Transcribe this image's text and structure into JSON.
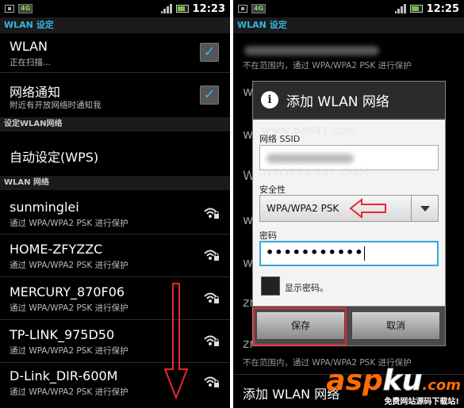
{
  "statusbar": {
    "time": "12:23",
    "time_right": "12:25",
    "network": "4G"
  },
  "left": {
    "header": "WLAN 设定",
    "wlan": {
      "title": "WLAN",
      "sub": "正在扫描..."
    },
    "notify": {
      "title": "网络通知",
      "sub": "附近有开放网络时通知我"
    },
    "section_setup": "设定WLAN网络",
    "wps": "自动设定(WPS)",
    "section_networks": "WLAN 网络",
    "networks": [
      {
        "ssid": "sunminglei",
        "sub": "通过 WPA/WPA2 PSK 进行保护"
      },
      {
        "ssid": "HOME-ZFYZZC",
        "sub": "通过 WPA/WPA2 PSK 进行保护"
      },
      {
        "ssid": "MERCURY_870F06",
        "sub": "通过 WPA/WPA2 PSK 进行保护"
      },
      {
        "ssid": "TP-LINK_975D50",
        "sub": "通过 WPA/WPA2 PSK 进行保护"
      },
      {
        "ssid": "D-Link_DIR-600M",
        "sub": "通过 WPA/WPA2 PSK 进行保护"
      }
    ],
    "check_glyph": "✓"
  },
  "right": {
    "header": "WLAN 设定",
    "out_of_range": "不在范围内，通过 WPA/WPA2 PSK 进行保护",
    "add_network": "添加 WLAN 网络",
    "zr": "zr"
  },
  "dialog": {
    "title": "添加 WLAN 网络",
    "info_glyph": "i",
    "ssid_label": "网络 SSID",
    "security_label": "安全性",
    "security_value": "WPA/WPA2 PSK",
    "password_label": "密码",
    "password_value": "•••••••••••",
    "show_password": "显示密码。",
    "save": "保存",
    "cancel": "取消"
  },
  "watermark": {
    "line1": "www.pc841.com",
    "line2": "WWW.PC841.COM",
    "logo_a": "asp",
    "logo_b": "ku",
    "logo_dot": ".com",
    "logo_sub": "免费网站源码下载站!"
  },
  "colors": {
    "accent": "#33b5e5",
    "red": "#e8262d",
    "logo_orange": "#ff6d00"
  }
}
